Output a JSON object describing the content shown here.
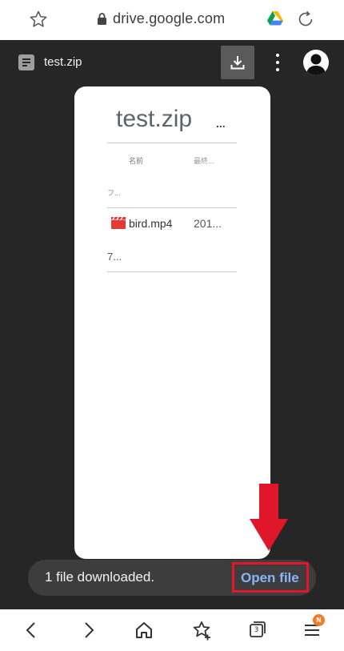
{
  "browser": {
    "url": "drive.google.com",
    "icons": [
      "star-outline-icon",
      "lock-icon",
      "google-drive-icon",
      "reload-icon"
    ]
  },
  "viewer": {
    "file_name": "test.zip",
    "icons": [
      "document-icon",
      "download-icon",
      "more-vert-icon",
      "account-avatar-icon"
    ]
  },
  "preview": {
    "title": "test.zip",
    "title_more": "...",
    "columns": {
      "name": "名前",
      "modified": "最終..."
    },
    "folder_row": "フ...",
    "file": {
      "name": "bird.mp4",
      "date": "201...",
      "size": "7...",
      "icon": "video-clapper-icon",
      "icon_color": "#e53935"
    }
  },
  "toast": {
    "message": "1 file downloaded.",
    "action": "Open file",
    "action_color": "#8ab4f8",
    "highlight_color": "#e0162b"
  },
  "bottom_nav": {
    "items": [
      "back-icon",
      "forward-icon",
      "home-icon",
      "bookmarks-icon",
      "tabs-icon",
      "menu-icon"
    ],
    "tabs_count": "3",
    "menu_badge": "N",
    "badge_color": "#f47a25"
  }
}
